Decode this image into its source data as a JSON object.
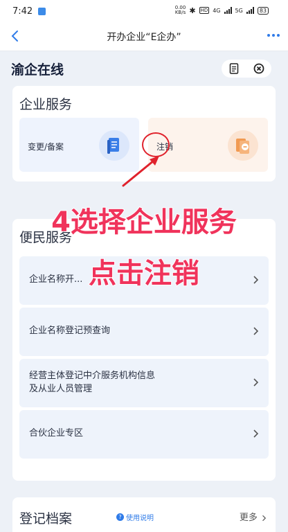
{
  "status_bar": {
    "time": "7:42",
    "net_speed_value": "0.00",
    "net_speed_unit": "KB/s",
    "hd": "HD",
    "net_4g": "4G",
    "net_5g": "5G",
    "battery": "83"
  },
  "header": {
    "back_icon": "chevron-left-icon",
    "title": "开办企业“E企办”",
    "more_icon": "more-dots-icon"
  },
  "page": {
    "title": "渝企在线"
  },
  "enterprise_services": {
    "title": "企业服务",
    "tiles": [
      {
        "label": "变更/备案",
        "icon": "document-icon"
      },
      {
        "label": "注销",
        "icon": "cancel-doc-icon"
      }
    ]
  },
  "citizen_services": {
    "title": "便民服务",
    "items": [
      {
        "label_line1": "企业名称开...",
        "label_line2": ""
      },
      {
        "label_line1": "企业名称登记预查询",
        "label_line2": ""
      },
      {
        "label_line1": "经营主体登记中介服务机构信息",
        "label_line2": "及从业人员管理"
      },
      {
        "label_line1": "合伙企业专区",
        "label_line2": ""
      }
    ]
  },
  "archive": {
    "title": "登记档案",
    "usage_label": "使用说明",
    "more_label": "更多"
  },
  "annotation": {
    "line1": "4选择企业服务",
    "line2": "点击注销",
    "color": "#f0335b"
  }
}
